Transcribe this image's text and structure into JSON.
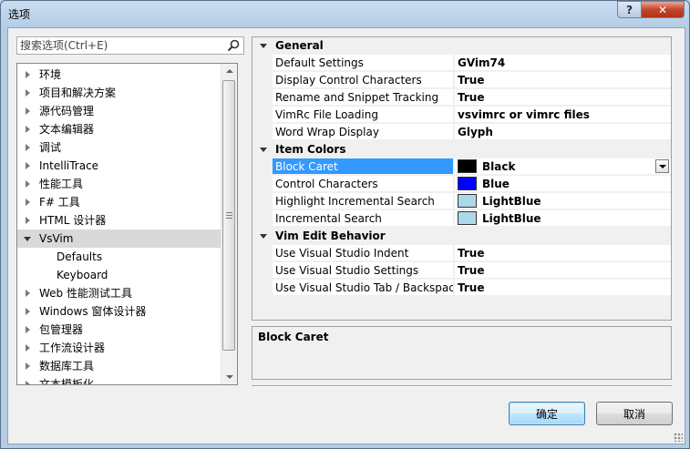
{
  "window": {
    "title": "选项",
    "help_label": "?",
    "close_label": "✕"
  },
  "search": {
    "placeholder": "搜索选项(Ctrl+E)",
    "icon": "search-icon"
  },
  "tree": {
    "items": [
      {
        "label": "环境",
        "expanded": false
      },
      {
        "label": "项目和解决方案",
        "expanded": false
      },
      {
        "label": "源代码管理",
        "expanded": false
      },
      {
        "label": "文本编辑器",
        "expanded": false
      },
      {
        "label": "调试",
        "expanded": false
      },
      {
        "label": "IntelliTrace",
        "expanded": false
      },
      {
        "label": "性能工具",
        "expanded": false
      },
      {
        "label": "F# 工具",
        "expanded": false
      },
      {
        "label": "HTML 设计器",
        "expanded": false
      },
      {
        "label": "VsVim",
        "expanded": true,
        "selected": true
      },
      {
        "label": "Defaults",
        "child": true
      },
      {
        "label": "Keyboard",
        "child": true
      },
      {
        "label": "Web 性能测试工具",
        "expanded": false
      },
      {
        "label": "Windows 窗体设计器",
        "expanded": false
      },
      {
        "label": "包管理器",
        "expanded": false
      },
      {
        "label": "工作流设计器",
        "expanded": false
      },
      {
        "label": "数据库工具",
        "expanded": false
      },
      {
        "label": "文本模板化",
        "expanded": false
      }
    ]
  },
  "property_grid": {
    "categories": [
      {
        "name": "General",
        "rows": [
          {
            "name": "Default Settings",
            "value": "GVim74"
          },
          {
            "name": "Display Control Characters",
            "value": "True"
          },
          {
            "name": "Rename and Snippet Tracking",
            "value": "True"
          },
          {
            "name": "VimRc File Loading",
            "value": "vsvimrc or vimrc files"
          },
          {
            "name": "Word Wrap Display",
            "value": "Glyph"
          }
        ]
      },
      {
        "name": "Item Colors",
        "rows": [
          {
            "name": "Block Caret",
            "value": "Black",
            "color": "#000000",
            "selected": true
          },
          {
            "name": "Control Characters",
            "value": "Blue",
            "color": "#0000ff"
          },
          {
            "name": "Highlight Incremental Search",
            "value": "LightBlue",
            "color": "#add8e6"
          },
          {
            "name": "Incremental Search",
            "value": "LightBlue",
            "color": "#add8e6"
          }
        ]
      },
      {
        "name": "Vim Edit Behavior",
        "rows": [
          {
            "name": "Use Visual Studio Indent",
            "value": "True"
          },
          {
            "name": "Use Visual Studio Settings",
            "value": "True"
          },
          {
            "name": "Use Visual Studio Tab / Backspace",
            "value": "True"
          }
        ]
      }
    ]
  },
  "description": {
    "title": "Block Caret"
  },
  "buttons": {
    "ok": "确定",
    "cancel": "取消"
  },
  "colors": {
    "selection": "#3399ff",
    "tree_selected": "#d9d9d9"
  }
}
